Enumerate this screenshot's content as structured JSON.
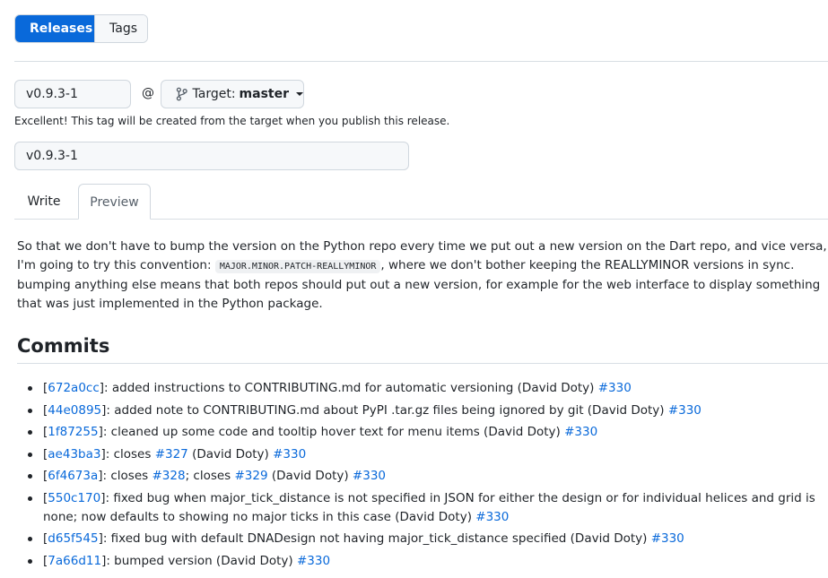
{
  "tabs_top": {
    "releases": "Releases",
    "tags": "Tags"
  },
  "tag_input": {
    "value": "v0.9.3-1"
  },
  "at_sign": "@",
  "target": {
    "label": "Target:",
    "value": "master"
  },
  "hint": "Excellent! This tag will be created from the target when you publish this release.",
  "title_input": {
    "value": "v0.9.3-1"
  },
  "editor_tabs": {
    "write": "Write",
    "preview": "Preview"
  },
  "description": {
    "part1": "So that we don't have to bump the version on the Python repo every time we put out a new version on the Dart repo, and vice versa, I'm going to try this convention: ",
    "code": "MAJOR.MINOR.PATCH-REALLYMINOR",
    "part2": ", where we don't bother keeping the REALLYMINOR versions in sync. bumping anything else means that both repos should put out a new version, for example for the web interface to display something that was just implemented in the Python package."
  },
  "commits_heading": "Commits",
  "commits": [
    {
      "sha": "672a0cc",
      "text": "]: added instructions to CONTRIBUTING.md for automatic versioning (David Doty) ",
      "pr": "#330"
    },
    {
      "sha": "44e0895",
      "text": "]: added note to CONTRIBUTING.md about PyPI .tar.gz files being ignored by git (David Doty) ",
      "pr": "#330"
    },
    {
      "sha": "1f87255",
      "text": "]: cleaned up some code and tooltip hover text for menu items (David Doty) ",
      "pr": "#330"
    },
    {
      "sha": "ae43ba3",
      "text1": "]: closes ",
      "ref1": "#327",
      "text": " (David Doty) ",
      "pr": "#330"
    },
    {
      "sha": "6f4673a",
      "text1": "]: closes ",
      "ref1": "#328",
      "text2": "; closes ",
      "ref2": "#329",
      "text": " (David Doty) ",
      "pr": "#330"
    },
    {
      "sha": "550c170",
      "text": "]: fixed bug when major_tick_distance is not specified in JSON for either the design or for individual helices and grid is none; now defaults to showing no major ticks in this case (David Doty) ",
      "pr": "#330"
    },
    {
      "sha": "d65f545",
      "text": "]: fixed bug with default DNADesign not having major_tick_distance specified (David Doty) ",
      "pr": "#330"
    },
    {
      "sha": "7a66d11",
      "text": "]: bumped version (David Doty) ",
      "pr": "#330"
    }
  ]
}
